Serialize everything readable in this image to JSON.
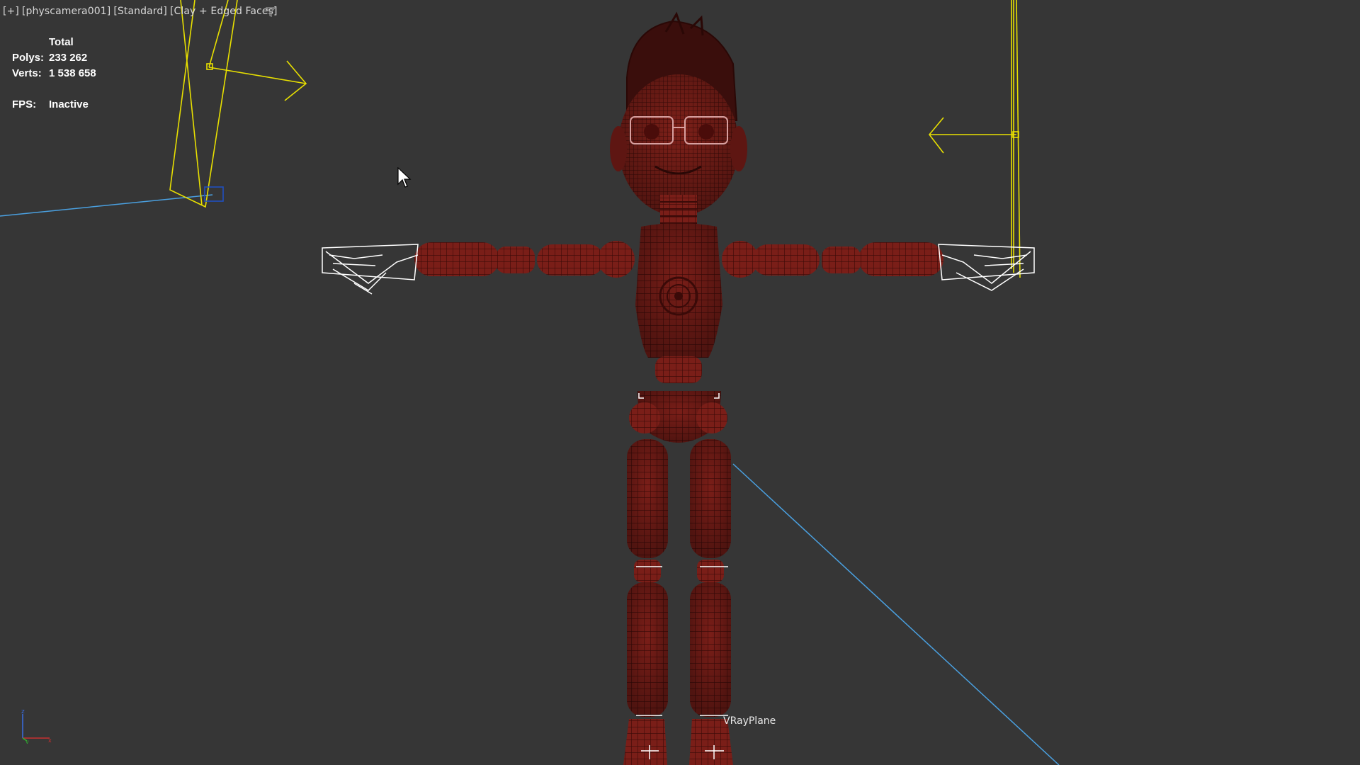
{
  "viewport": {
    "label_parts": [
      "[+]",
      "[physcamera001]",
      "[Standard]",
      "[Clay + Edged Faces]"
    ]
  },
  "stats": {
    "header": "Total",
    "polys_label": "Polys:",
    "polys_value": "233 262",
    "verts_label": "Verts:",
    "verts_value": "1 538 658",
    "fps_label": "FPS:",
    "fps_value": "Inactive"
  },
  "scene": {
    "object_label": "VRayPlane",
    "model_color": "#7a1e18",
    "wire_color": "#3a0a08",
    "light_color": "#e8e000",
    "line_color": "#4aa0e0"
  },
  "axis": {
    "z_label": "z",
    "y_label": "y",
    "x_label": "x"
  },
  "icons": [
    "filter-icon",
    "mouse-cursor-icon",
    "axis-tripod-icon"
  ]
}
